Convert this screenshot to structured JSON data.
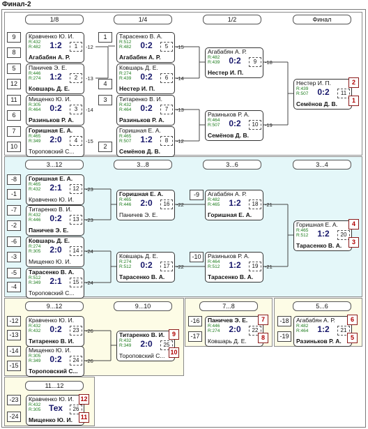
{
  "title": "Финал-2",
  "sections": {
    "final": {
      "headers": [
        "1/8",
        "1/4",
        "1/2",
        "Финал"
      ],
      "seeds": [
        "9",
        "8",
        "5",
        "12",
        "11",
        "6",
        "7",
        "10",
        "1",
        "4",
        "3",
        "2"
      ],
      "matches": [
        {
          "p1": "Кравченко Ю. И.",
          "p2": "Агабабян А. Р.",
          "r1": "R:432",
          "r2": "R:482",
          "score": "1:2",
          "num": "1",
          "next": "-12",
          "win": 2
        },
        {
          "p1": "Паничев Э. Е.",
          "p2": "Ковшарь Д. Е.",
          "r1": "R:446",
          "r2": "R:274",
          "score": "1:2",
          "num": "2",
          "next": "-13",
          "win": 2
        },
        {
          "p1": "Мищенко Ю. И.",
          "p2": "Разиньков Р. А.",
          "r1": "R:305",
          "r2": "R:464",
          "score": "0:2",
          "num": "3",
          "next": "-14",
          "win": 2
        },
        {
          "p1": "Горишная Е. А.",
          "p2": "Тороповский С...",
          "r1": "R:465",
          "r2": "R:349",
          "score": "2:0",
          "num": "4",
          "next": "-15",
          "win": 1
        },
        {
          "p1": "Тарасенко В. А.",
          "p2": "Агабабян А. Р.",
          "r1": "R:512",
          "r2": "R:482",
          "score": "0:2",
          "num": "5",
          "next": "-15",
          "win": 2
        },
        {
          "p1": "Ковшарь Д. Е.",
          "p2": "Нестер И. П.",
          "r1": "R:274",
          "r2": "R:439",
          "score": "0:2",
          "num": "6",
          "next": "-14",
          "win": 2
        },
        {
          "p1": "Титаренко В. И.",
          "p2": "Разиньков Р. А.",
          "r1": "R:432",
          "r2": "R:464",
          "score": "0:2",
          "num": "7",
          "next": "-13",
          "win": 2
        },
        {
          "p1": "Горишная Е. А.",
          "p2": "Семёнов Д. В.",
          "r1": "R:465",
          "r2": "R:507",
          "score": "1:2",
          "num": "8",
          "next": "-12",
          "win": 2
        },
        {
          "p1": "Агабабян А. Р.",
          "p2": "Нестер И. П.",
          "r1": "R:482",
          "r2": "R:439",
          "score": "0:2",
          "num": "9",
          "next": "-18",
          "win": 2
        },
        {
          "p1": "Разиньков Р. А.",
          "p2": "Семёнов Д. В.",
          "r1": "R:464",
          "r2": "R:507",
          "score": "0:2",
          "num": "10",
          "next": "-19",
          "win": 2
        },
        {
          "p1": "Нестер И. П.",
          "p2": "Семёнов Д. В.",
          "r1": "R:439",
          "r2": "R:507",
          "score": "0:2",
          "num": "11",
          "next": "",
          "win": 2
        }
      ],
      "places": [
        "2",
        "1"
      ]
    },
    "s3_12": {
      "headers": [
        "3...12",
        "3...8",
        "3...6",
        "3...4"
      ],
      "seeds": [
        "-8",
        "-1",
        "-7",
        "-2",
        "-6",
        "-3",
        "-5",
        "-4",
        "-9",
        "-10"
      ],
      "matches": [
        {
          "p1": "Горишная Е. А.",
          "p2": "Кравченко Ю. И.",
          "r1": "R:465",
          "r2": "R:432",
          "score": "2:1",
          "num": "12",
          "next": "-23",
          "win": 1
        },
        {
          "p1": "Титаренко В. И.",
          "p2": "Паничев Э. Е.",
          "r1": "R:432",
          "r2": "R:446",
          "score": "0:2",
          "num": "13",
          "next": "-23",
          "win": 2
        },
        {
          "p1": "Ковшарь Д. Е.",
          "p2": "Мищенко Ю. И.",
          "r1": "R:274",
          "r2": "R:305",
          "score": "2:0",
          "num": "14",
          "next": "-24",
          "win": 1
        },
        {
          "p1": "Тарасенко В. А.",
          "p2": "Тороповский С...",
          "r1": "R:512",
          "r2": "R:349",
          "score": "2:1",
          "num": "15",
          "next": "-24",
          "win": 1
        },
        {
          "p1": "Горишная Е. А.",
          "p2": "Паничев Э. Е.",
          "r1": "R:465",
          "r2": "R:446",
          "score": "2:0",
          "num": "16",
          "next": "-22",
          "win": 1
        },
        {
          "p1": "Ковшарь Д. Е.",
          "p2": "Тарасенко В. А.",
          "r1": "R:274",
          "r2": "R:512",
          "score": "0:2",
          "num": "17",
          "next": "-22",
          "win": 2
        },
        {
          "p1": "Агабабян А. Р.",
          "p2": "Горишная Е. А.",
          "r1": "R:482",
          "r2": "R:465",
          "score": "1:2",
          "num": "18",
          "next": "-21",
          "win": 2
        },
        {
          "p1": "Разиньков Р. А.",
          "p2": "Тарасенко В. А.",
          "r1": "R:464",
          "r2": "R:512",
          "score": "1:2",
          "num": "19",
          "next": "-21",
          "win": 2
        },
        {
          "p1": "Горишная Е. А.",
          "p2": "Тарасенко В. А.",
          "r1": "R:465",
          "r2": "R:512",
          "score": "1:2",
          "num": "20",
          "next": "",
          "win": 2
        }
      ],
      "places": [
        "4",
        "3"
      ]
    },
    "s9_12": {
      "headers": [
        "9...12",
        "9...10"
      ],
      "seeds": [
        "-12",
        "-13",
        "-14",
        "-15"
      ],
      "matches": [
        {
          "p1": "Кравченко Ю. И.",
          "p2": "Титаренко В. И.",
          "r1": "R:432",
          "r2": "R:432",
          "score": "0:2",
          "num": "23",
          "next": "-26",
          "win": 2
        },
        {
          "p1": "Мищенко Ю. И.",
          "p2": "Тороповский С...",
          "r1": "R:305",
          "r2": "R:349",
          "score": "0:2",
          "num": "24",
          "next": "-26",
          "win": 2
        },
        {
          "p1": "Титаренко В. И.",
          "p2": "Тороповский С...",
          "r1": "R:432",
          "r2": "R:349",
          "score": "2:0",
          "num": "25",
          "next": "",
          "win": 1
        }
      ],
      "places": [
        "9",
        "10"
      ]
    },
    "s7_8": {
      "header": "7...8",
      "seeds": [
        "-16",
        "-17"
      ],
      "match": {
        "p1": "Паничев Э. Е.",
        "p2": "Ковшарь Д. Е.",
        "r1": "R:446",
        "r2": "R:274",
        "score": "2:0",
        "num": "22",
        "win": 1
      },
      "places": [
        "7",
        "8"
      ]
    },
    "s5_6": {
      "header": "5...6",
      "seeds": [
        "-18",
        "-19"
      ],
      "match": {
        "p1": "Агабабян А. Р.",
        "p2": "Разиньков Р. А.",
        "r1": "R:482",
        "r2": "R:464",
        "score": "1:2",
        "num": "21",
        "win": 2
      },
      "places": [
        "6",
        "5"
      ]
    },
    "s11_12": {
      "header": "11...12",
      "seeds": [
        "-23",
        "-24"
      ],
      "match": {
        "p1": "Кравченко Ю. И.",
        "p2": "Мищенко Ю. И.",
        "r1": "R:432",
        "r2": "R:305",
        "score": "Тех",
        "num": "26",
        "win": 2
      },
      "places": [
        "12",
        "11"
      ]
    }
  },
  "colors": {
    "blue_bg": "#e4f7f9",
    "yellow_bg": "#fdfce6",
    "place_red": "#b00000",
    "rating_green": "#1a7a1a"
  }
}
